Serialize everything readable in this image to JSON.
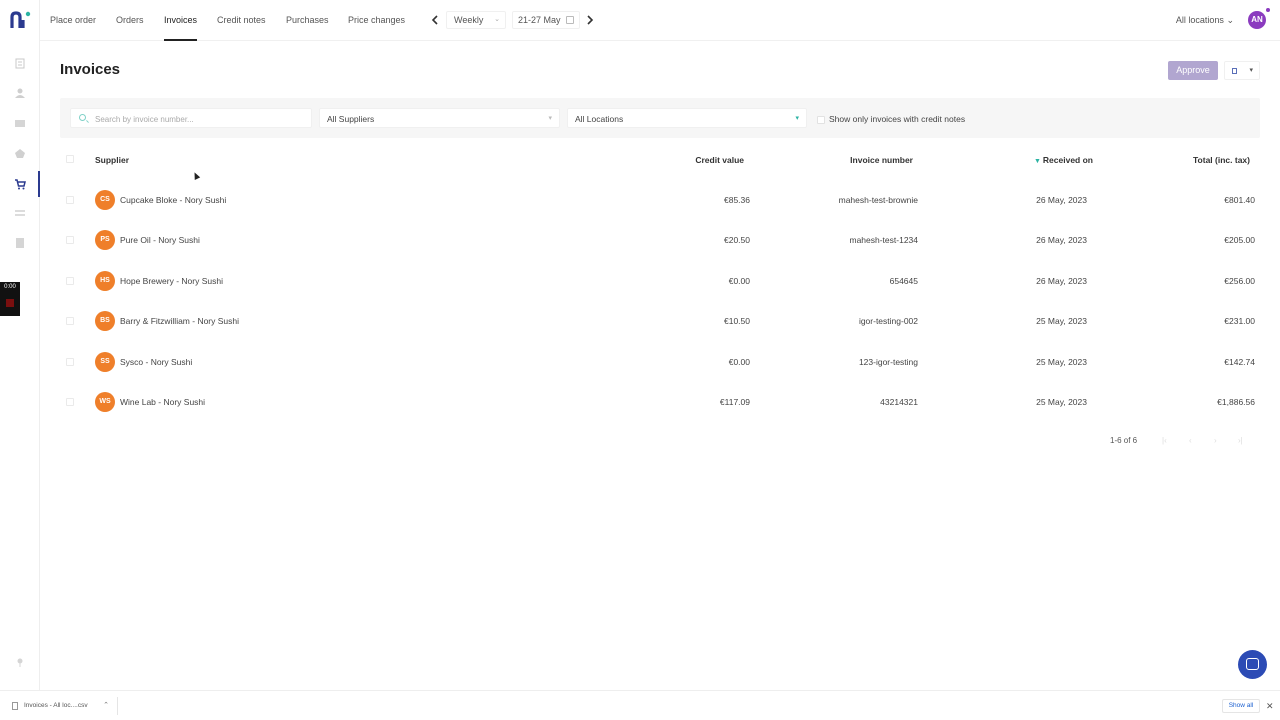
{
  "nav": {
    "tabs": [
      "Place order",
      "Orders",
      "Invoices",
      "Credit notes",
      "Purchases",
      "Price changes"
    ],
    "active_tab": "Invoices",
    "period": "Weekly",
    "date_range": "21-27 May",
    "location_filter": "All locations",
    "user_initials": "AN"
  },
  "sidebar": {
    "timer": "0:00"
  },
  "page": {
    "title": "Invoices",
    "approve_label": "Approve"
  },
  "filters": {
    "search_placeholder": "Search by invoice number...",
    "supplier": "All Suppliers",
    "location": "All Locations",
    "credit_toggle_label": "Show only invoices with credit notes"
  },
  "table": {
    "headers": {
      "supplier": "Supplier",
      "credit": "Credit value",
      "invoice_number": "Invoice number",
      "received": "Received on",
      "total": "Total (inc. tax)"
    },
    "rows": [
      {
        "initials": "CS",
        "supplier": "Cupcake Bloke - Nory Sushi",
        "credit": "€85.36",
        "invoice_number": "mahesh-test-brownie",
        "received": "26 May, 2023",
        "total": "€801.40"
      },
      {
        "initials": "PS",
        "supplier": "Pure Oil - Nory Sushi",
        "credit": "€20.50",
        "invoice_number": "mahesh-test-1234",
        "received": "26 May, 2023",
        "total": "€205.00"
      },
      {
        "initials": "HS",
        "supplier": "Hope Brewery - Nory Sushi",
        "credit": "€0.00",
        "invoice_number": "654645",
        "received": "26 May, 2023",
        "total": "€256.00"
      },
      {
        "initials": "BS",
        "supplier": "Barry & Fitzwilliam - Nory Sushi",
        "credit": "€10.50",
        "invoice_number": "igor-testing-002",
        "received": "25 May, 2023",
        "total": "€231.00"
      },
      {
        "initials": "SS",
        "supplier": "Sysco - Nory Sushi",
        "credit": "€0.00",
        "invoice_number": "123-igor-testing",
        "received": "25 May, 2023",
        "total": "€142.74"
      },
      {
        "initials": "WS",
        "supplier": "Wine Lab - Nory Sushi",
        "credit": "€117.09",
        "invoice_number": "43214321",
        "received": "25 May, 2023",
        "total": "€1,886.56"
      }
    ]
  },
  "pagination": {
    "summary": "1-6 of 6"
  },
  "downloads": {
    "file_label": "Invoices - All loc....csv",
    "show_all": "Show all"
  },
  "colors": {
    "brand": "#2b3a8f",
    "supplier_badge": "#ef7f2a",
    "approve_disabled": "#b1a6d0",
    "accent_teal": "#2bb3a3",
    "avatar": "#8b3bbf"
  }
}
